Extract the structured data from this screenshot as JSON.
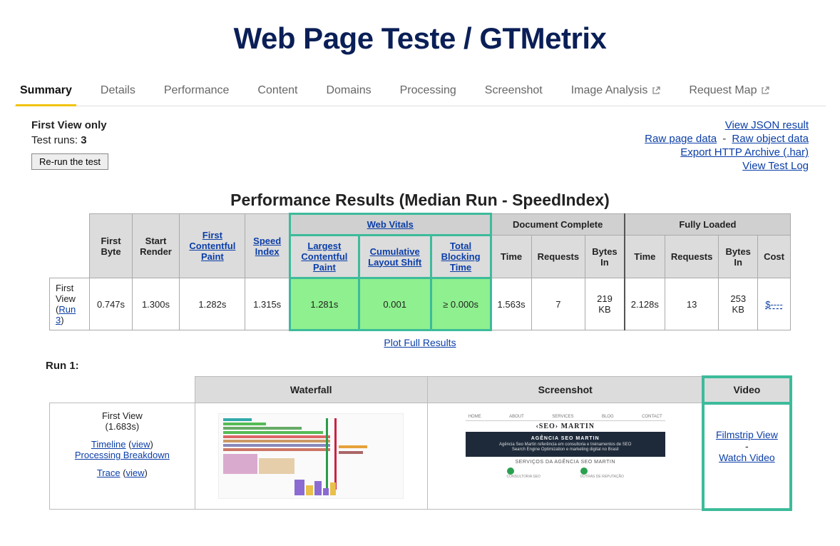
{
  "page_title": "Web Page Teste / GTMetrix",
  "tabs": [
    {
      "label": "Summary",
      "active": true
    },
    {
      "label": "Details"
    },
    {
      "label": "Performance"
    },
    {
      "label": "Content"
    },
    {
      "label": "Domains"
    },
    {
      "label": "Processing"
    },
    {
      "label": "Screenshot"
    },
    {
      "label": "Image Analysis",
      "ext": true
    },
    {
      "label": "Request Map",
      "ext": true
    }
  ],
  "summary": {
    "first_view_only": "First View only",
    "test_runs_label": "Test runs: ",
    "test_runs_n": "3",
    "rerun_btn": "Re-run the test",
    "links": {
      "view_json": "View JSON result",
      "raw_page": "Raw page data",
      "raw_object": "Raw object data",
      "export_har": "Export HTTP Archive (.har)",
      "view_log": "View Test Log"
    }
  },
  "perf": {
    "title": "Performance Results (Median Run - SpeedIndex)",
    "group_web_vitals": "Web Vitals",
    "group_doc_complete": "Document Complete",
    "group_fully_loaded": "Fully Loaded",
    "cols": {
      "first_byte": "First Byte",
      "start_render": "Start Render",
      "fcp": "First Contentful Paint",
      "speed_index": "Speed Index",
      "lcp": "Largest Contentful Paint",
      "cls": "Cumulative Layout Shift",
      "tbt": "Total Blocking Time",
      "time": "Time",
      "requests": "Requests",
      "bytes_in": "Bytes In",
      "cost": "Cost"
    },
    "row_label_prefix": "First View (",
    "row_label_link": "Run 3",
    "row_label_suffix": ")",
    "row": {
      "first_byte": "0.747s",
      "start_render": "1.300s",
      "fcp": "1.282s",
      "speed_index": "1.315s",
      "lcp": "1.281s",
      "cls": "0.001",
      "tbt": "≥ 0.000s",
      "dc_time": "1.563s",
      "dc_requests": "7",
      "dc_bytes": "219 KB",
      "fl_time": "2.128s",
      "fl_requests": "13",
      "fl_bytes": "253 KB",
      "cost": "$----"
    },
    "plot_link": "Plot Full Results"
  },
  "run1": {
    "label": "Run 1:",
    "col_waterfall": "Waterfall",
    "col_screenshot": "Screenshot",
    "col_video": "Video",
    "firstview_label": "First View",
    "firstview_time": "(1.683s)",
    "timeline": "Timeline",
    "view": "view",
    "processing_breakdown": "Processing Breakdown",
    "trace": "Trace",
    "filmstrip": "Filmstrip View",
    "watch_video": "Watch Video",
    "screenshot_preview": {
      "logo": "‹SEO› MARTIN",
      "hero_title": "AGÊNCIA SEO MARTIN",
      "services_title": "SERVIÇOS DA AGÊNCIA SEO MARTIN",
      "cap1": "CONSULTORIA SEO",
      "cap2": "OUTRAS DE REPUTAÇÃO"
    }
  }
}
